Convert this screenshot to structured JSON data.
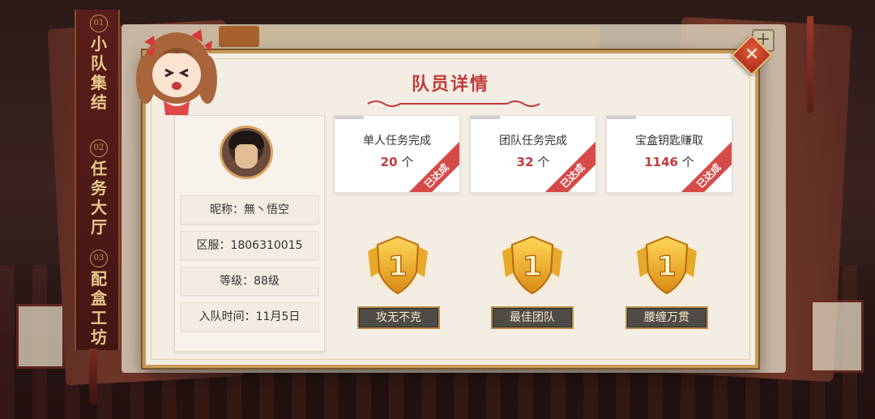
{
  "side_tabs": [
    {
      "num": "01",
      "label": "小队集结"
    },
    {
      "num": "02",
      "label": "任务大厅"
    },
    {
      "num": "03",
      "label": "配盒工坊"
    }
  ],
  "dialog": {
    "title": "队员详情",
    "close_label": "✕"
  },
  "profile": {
    "nickname": "昵称：無丶悟空",
    "server": "区服：1806310015",
    "level": "等级：88级",
    "join_time": "入队时间：11月5日"
  },
  "stats": [
    {
      "label": "单人任务完成",
      "value": "20",
      "unit": "个",
      "status": "已达成"
    },
    {
      "label": "团队任务完成",
      "value": "32",
      "unit": "个",
      "status": "已达成"
    },
    {
      "label": "宝盒钥匙赚取",
      "value": "1146",
      "unit": "个",
      "status": "已达成"
    }
  ],
  "badges": [
    {
      "rank": "1",
      "label": "攻无不克"
    },
    {
      "rank": "1",
      "label": "最佳团队"
    },
    {
      "rank": "1",
      "label": "腰缠万贯"
    }
  ],
  "background": {
    "plus_icon": "+"
  },
  "colors": {
    "accent_red": "#c23a3a",
    "gold": "#e6a92a",
    "dialog_bg": "#f3ede4"
  }
}
